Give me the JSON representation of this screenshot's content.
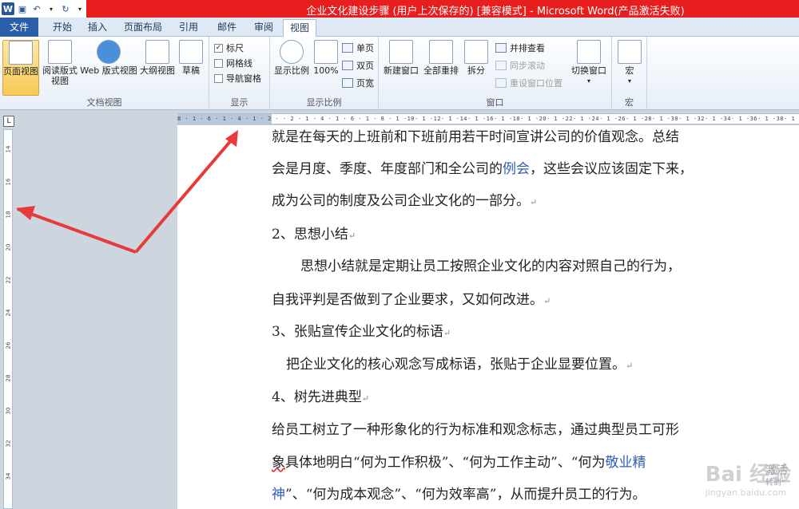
{
  "window": {
    "title": "企业文化建设步骤 (用户上次保存的) [兼容模式] - Microsoft Word(产品激活失败)"
  },
  "quick_access": {
    "app_icon": "W",
    "items": [
      "save-icon",
      "undo-icon",
      "redo-icon",
      "customize-icon"
    ]
  },
  "tabs": [
    {
      "label": "文件"
    },
    {
      "label": "开始"
    },
    {
      "label": "插入"
    },
    {
      "label": "页面布局"
    },
    {
      "label": "引用"
    },
    {
      "label": "邮件"
    },
    {
      "label": "审阅"
    },
    {
      "label": "视图"
    }
  ],
  "ribbon": {
    "doc_views": {
      "label": "文档视图",
      "buttons": [
        "页面视图",
        "阅读版式视图",
        "Web 版式视图",
        "大纲视图",
        "草稿"
      ],
      "read_line1": "阅读版式",
      "read_line2": "视图",
      "web_label": "Web 版式视图"
    },
    "show": {
      "label": "显示",
      "ruler": "标尺",
      "gridlines": "网格线",
      "nav_pane": "导航窗格",
      "ruler_checked": true
    },
    "zoom": {
      "label": "显示比例",
      "zoom_btn": "显示比例",
      "hundred": "100%",
      "one_page": "单页",
      "two_pages": "双页",
      "page_width": "页宽"
    },
    "window": {
      "label": "窗口",
      "new_window": "新建窗口",
      "arrange_all": "全部重排",
      "split": "拆分",
      "side_by_side": "并排查看",
      "sync_scroll": "同步滚动",
      "reset_pos": "重设窗口位置",
      "switch_windows": "切换窗口"
    },
    "macros": {
      "label": "宏",
      "btn": "宏"
    }
  },
  "ruler": {
    "corner": "L",
    "h_ticks": "8 · 1 · 6 · 1 · 4 · 1 · 2 ·  · 2 · 1 · 4 · 1 · 6 · 1 · 8 · 1 ·10· 1 ·12· 1 ·14· 1 ·16· 1 ·18· 1 ·20· 1 ·22· 1 ·24· 1 ·26· 1 ·28· 1 ·30· 1 ·32· 1 ·34· 1 ·36· 1 ·38· 1 ·40· 1 ·42· 1 ·44· 1 ·46· 1 ·48",
    "v_ticks": [
      "14",
      "16",
      "18",
      "20",
      "22",
      "24",
      "26",
      "28",
      "30",
      "32",
      "34"
    ]
  },
  "document": {
    "line1": "就是在每天的上班前和下班前用若干时间宣讲公司的价值观念。总结",
    "line2_a": "会是月度、季度、年度部门和全公司的",
    "line2_link": "例会",
    "line2_b": "，这些会议应该固定下来，",
    "line3": "成为公司的制度及公司企业文化的一部分。",
    "h2": "2、思想小结",
    "p2_line1": "思想小结就是定期让员工按照企业文化的内容对照自己的行为，",
    "p2_line2": "自我评判是否做到了企业要求，又如何改进。",
    "h3": "3、张贴宣传企业文化的标语",
    "p3": "把企业文化的核心观念写成标语，张贴于企业显要位置。",
    "h4": "4、树先进典型",
    "p4_line1": "给员工树立了一种形象化的行为标准和观念标志，通过典型员工可形",
    "p4_line2_a": "象",
    "p4_line2_b": "具体地明白“何为工作积极”、“何为工作主动”、“何为",
    "p4_line2_link": "敬业精",
    "p4_line3_link": "神",
    "p4_line3_b": "”、“何为成本观念”、“何为效率高”，从而提升员工的行为。",
    "para_mark": "↵"
  },
  "overlay": {
    "baidu_watermark": "Bai 经验",
    "baidu_sub": "jingyan.baidu.com",
    "activate_line1": "激活",
    "activate_line2": "转到“"
  },
  "colors": {
    "title_bar": "#e81e1e",
    "file_tab": "#2a5ea8",
    "arrow": "#e83a3a",
    "link": "#2e5fb8"
  }
}
